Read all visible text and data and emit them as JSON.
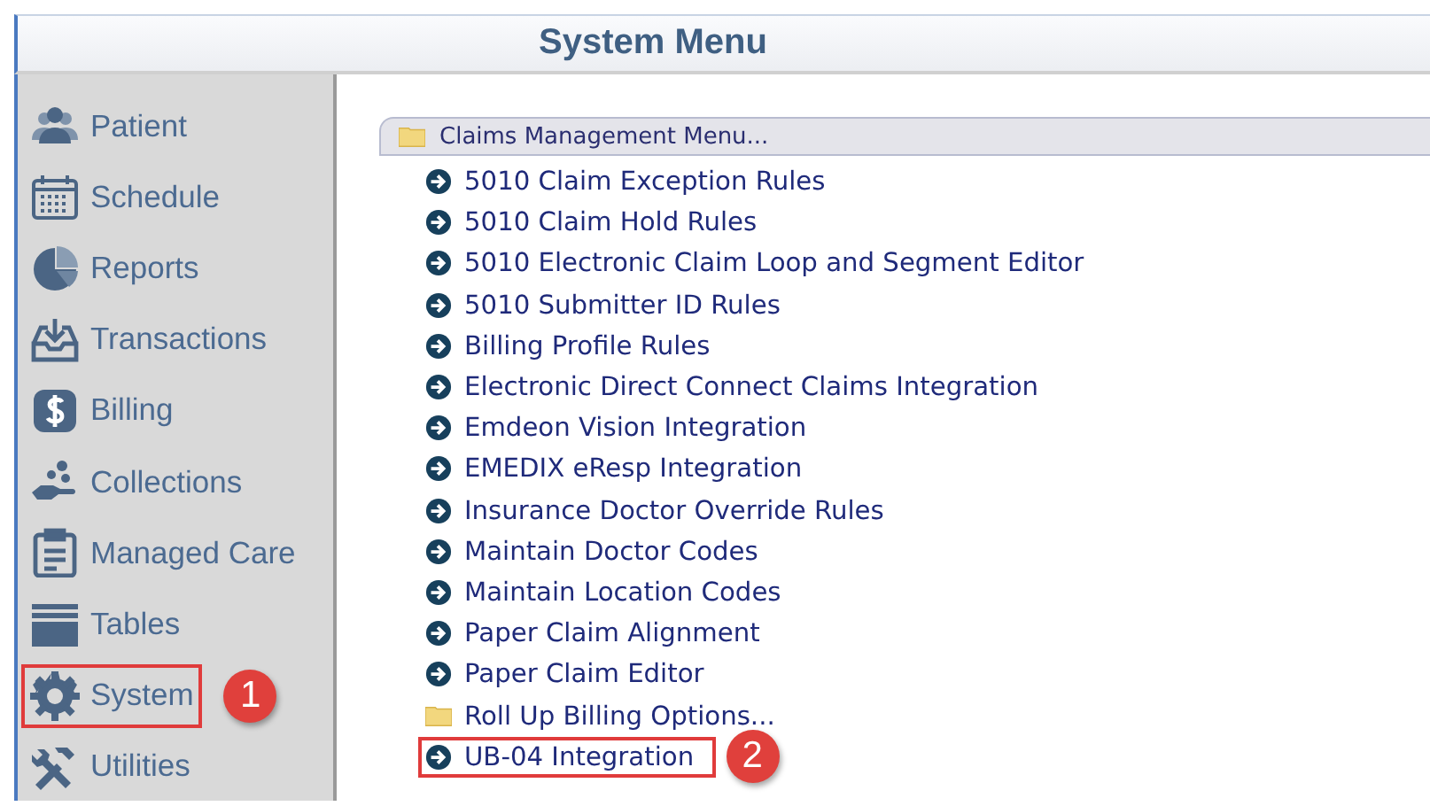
{
  "window": {
    "title": "System Menu"
  },
  "sidebar": {
    "items": [
      {
        "label": "Patient"
      },
      {
        "label": "Schedule"
      },
      {
        "label": "Reports"
      },
      {
        "label": "Transactions"
      },
      {
        "label": "Billing"
      },
      {
        "label": "Collections"
      },
      {
        "label": "Managed Care"
      },
      {
        "label": "Tables"
      },
      {
        "label": "System",
        "callout": "1"
      },
      {
        "label": "Utilities"
      }
    ]
  },
  "menu": {
    "title": "Claims Management Menu...",
    "items": [
      {
        "kind": "link",
        "label": "5010 Claim Exception Rules"
      },
      {
        "kind": "link",
        "label": "5010 Claim Hold Rules"
      },
      {
        "kind": "link",
        "label": "5010 Electronic Claim Loop and Segment Editor"
      },
      {
        "kind": "link",
        "label": "5010 Submitter ID Rules"
      },
      {
        "kind": "link",
        "label": "Billing Profile Rules"
      },
      {
        "kind": "link",
        "label": "Electronic Direct Connect Claims Integration"
      },
      {
        "kind": "link",
        "label": "Emdeon Vision Integration"
      },
      {
        "kind": "link",
        "label": "EMEDIX eResp Integration"
      },
      {
        "kind": "link",
        "label": "Insurance Doctor Override Rules"
      },
      {
        "kind": "link",
        "label": "Maintain Doctor Codes"
      },
      {
        "kind": "link",
        "label": "Maintain Location Codes"
      },
      {
        "kind": "link",
        "label": "Paper Claim Alignment"
      },
      {
        "kind": "link",
        "label": "Paper Claim Editor"
      },
      {
        "kind": "folder",
        "label": "Roll Up Billing Options..."
      },
      {
        "kind": "link",
        "label": "UB-04 Integration",
        "callout": "2"
      }
    ]
  }
}
